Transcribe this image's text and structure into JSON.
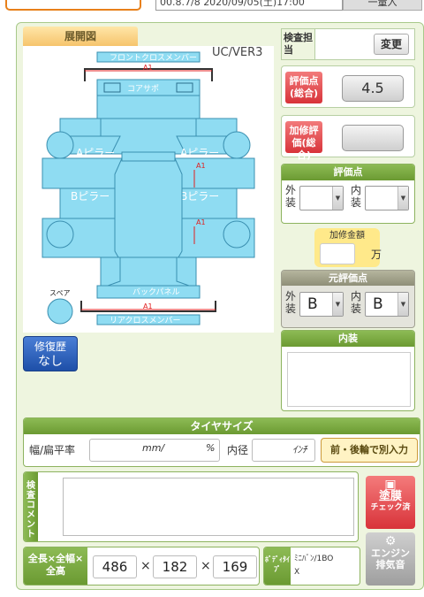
{
  "top": {
    "date_text": "00.8.7/8  2020/09/05(土)17:00",
    "right_text": "一量入"
  },
  "diagram": {
    "title": "展開図",
    "version": "UC/VER3",
    "parts": {
      "front_cross_member": "フロントクロスメンバー",
      "core_support": "コアサポ",
      "a_pillar_left": "Aピラー",
      "a_pillar_right": "Aピラー",
      "b_pillar_left": "Bピラー",
      "b_pillar_right": "Bピラー",
      "back_panel": "バックパネル",
      "rear_cross_member": "リアクロスメンバー",
      "spare": "スペア"
    },
    "marks": {
      "front": "A1",
      "right_a": "A1",
      "right_b": "A1",
      "rear": "A1"
    }
  },
  "repair_history": {
    "label_line1": "修復歴",
    "label_line2": "なし"
  },
  "inspection": {
    "label": "検査担当",
    "change_button": "変更"
  },
  "score": {
    "label": "評価点(総合)",
    "value": "4.5"
  },
  "repair_score": {
    "label": "加修評価(総合)",
    "value": ""
  },
  "evaluation": {
    "title": "評価点",
    "exterior_label": "外装",
    "interior_label": "内装",
    "exterior_value": "",
    "interior_value": ""
  },
  "repair_amount": {
    "label": "加修金額",
    "unit": "万"
  },
  "original_eval": {
    "title": "元評価点",
    "exterior_label": "外装",
    "interior_label": "内装",
    "exterior_value": "B",
    "interior_value": "B"
  },
  "interior": {
    "title": "内装"
  },
  "tire": {
    "title": "タイヤサイズ",
    "width_label": "幅/扁平率",
    "width_unit": "mm/",
    "ratio_unit": "%",
    "inner_label": "内径",
    "inner_unit": "ｲﾝﾁ",
    "separate_button": "前・後輪で別入力"
  },
  "comment": {
    "label": "検査コメント"
  },
  "paint_button": {
    "line1": "塗膜",
    "line2": "チェック済"
  },
  "engine_button": {
    "line1": "エンジン",
    "line2": "排気音"
  },
  "dimensions": {
    "label": "全長×全幅×全高",
    "length": "486",
    "width": "182",
    "height": "169",
    "separator": "×"
  },
  "body_type": {
    "label": "ﾎﾞﾃﾞｨﾀｲﾌﾟ",
    "value_line1": "ﾐﾆﾊﾞﾝ/1BO",
    "value_line2": "X"
  },
  "colors": {
    "panel_bg": "#eef5df",
    "green": "#7aa840",
    "car_blue": "#8fdcf2",
    "red_mark": "#e02020"
  }
}
